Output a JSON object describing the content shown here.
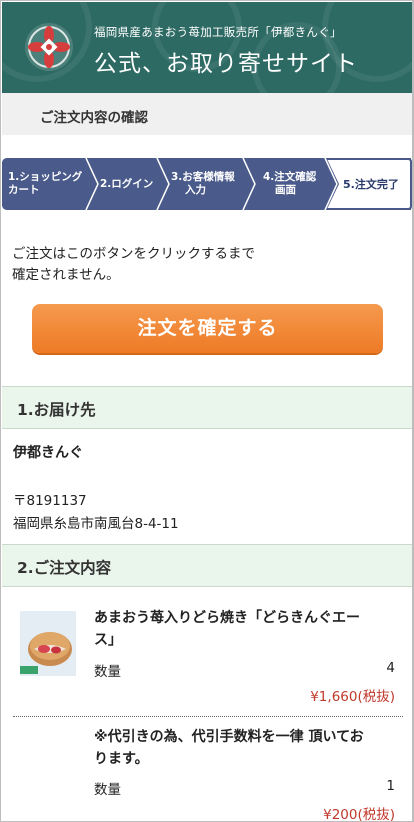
{
  "header": {
    "subtitle": "福岡県産あまおう苺加工販売所「伊都きんぐ」",
    "title": "公式、お取り寄せサイト"
  },
  "page": {
    "title": "ご注文内容の確認"
  },
  "steps": [
    {
      "line1": "1.ショッピング",
      "line2": "カート",
      "active": false
    },
    {
      "line1": "2.ログイン",
      "line2": "",
      "active": false
    },
    {
      "line1": "3.お客様情報",
      "line2": "入力",
      "active": false
    },
    {
      "line1": "4.注文確認",
      "line2": "画面",
      "active": false
    },
    {
      "line1": "5.注文完了",
      "line2": "",
      "active": true
    }
  ],
  "notice": {
    "line1": "ご注文はこのボタンをクリックするまで",
    "line2": "確定されません。"
  },
  "confirm_button": {
    "label": "注文を確定する"
  },
  "delivery": {
    "heading": "1.お届け先",
    "name": "伊都きんぐ",
    "zip": "〒8191137",
    "address": "福岡県糸島市南風台8-4-11"
  },
  "order": {
    "heading": "2.ご注文内容",
    "items": [
      {
        "name_line1": "あまおう苺入りどら焼き「どらきんぐエー",
        "name_line2": "ス」",
        "qty_label": "数量",
        "qty": "4",
        "price": "¥1,660(税抜)"
      },
      {
        "name_line1": "※代引きの為、代引手数料を一律 頂いてお",
        "name_line2": "ります。",
        "qty_label": "数量",
        "qty": "1",
        "price": "¥200(税抜)"
      }
    ]
  },
  "colors": {
    "header_bg": "#2d6a63",
    "step_bg": "#4a5a8a",
    "accent_orange": "#ee7a25",
    "price_red": "#c0392b",
    "section_bg": "#eaf5ec"
  }
}
